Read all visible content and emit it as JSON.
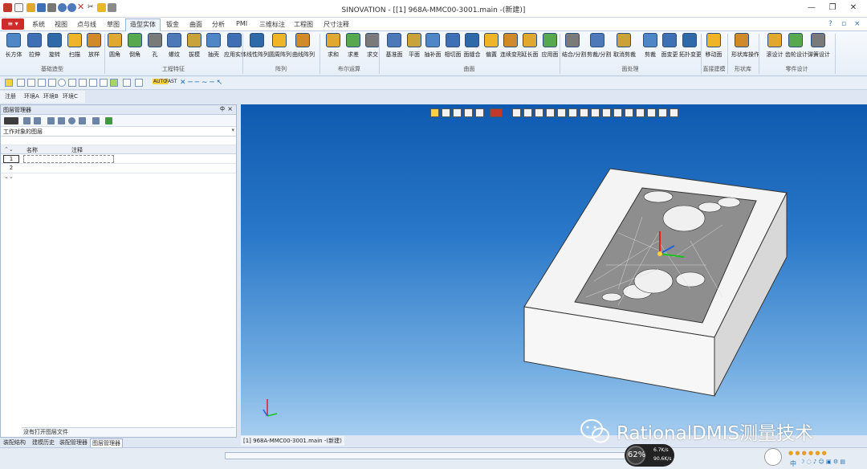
{
  "window": {
    "title": "SINOVATION - [[1] 968A-MMC00-3001.main -(新建)]"
  },
  "menu": {
    "items": [
      "系统",
      "视图",
      "点与线",
      "草图",
      "造型实体",
      "钣金",
      "曲面",
      "分析",
      "PMI",
      "三维标注",
      "工程图",
      "尺寸注释"
    ],
    "active": "造型实体"
  },
  "ribbon": {
    "buttons": [
      "长方体",
      "拉伸",
      "旋转",
      "扫描",
      "放样",
      "圆角",
      "倒角",
      "孔",
      "螺纹",
      "拔模",
      "抽壳",
      "应用实体",
      "线性阵列",
      "圆周阵列",
      "曲线阵列",
      "求和",
      "求差",
      "求交",
      "基准面",
      "平面",
      "抽补面",
      "相切面",
      "面缝合",
      "偏置",
      "连续变形",
      "延长面",
      "应用面",
      "结合/分割",
      "剪裁/分割",
      "取消剪裁",
      "剪裁",
      "面变更",
      "拓扑变更",
      "移动面",
      "形状库操作",
      "滚设计",
      "齿轮设计",
      "弹簧设计"
    ],
    "groups": [
      "基础造型",
      "工程特征",
      "阵列",
      "布尔运算",
      "曲面",
      "面处理",
      "直接建模",
      "形状库",
      "零件设计"
    ]
  },
  "toolbar2": {
    "auto": "AUTO",
    "fast": "FAST"
  },
  "env_tabs": [
    "注册",
    "环境A",
    "环境B",
    "环境C"
  ],
  "panel": {
    "title": "图层管理器",
    "pin": "ф",
    "close": "×",
    "layer_select": "工作对象的图层",
    "columns": [
      "名称",
      "注释"
    ],
    "rows": [
      "1",
      "2"
    ],
    "status": "没有打开图层文件"
  },
  "bottom_tabs": [
    "装配结构",
    "建模历史",
    "装配管理器",
    "图层管理器"
  ],
  "active_bottom_tab": "图层管理器",
  "doc_tab": "[1] 968A-MMC00-3001.main -(新建)",
  "watermark": "RationalDMIS测量技术",
  "perf": {
    "percent": "62%",
    "up": "6.7K/s",
    "down": "90.6K/s"
  },
  "tray": {
    "ime": "中"
  },
  "colors": {
    "sky_top": "#0e5ab0",
    "sky_bottom": "#a5cdf0",
    "accent": "#cf2a2a",
    "axis_x": "#20c020",
    "axis_y": "#e02020"
  }
}
